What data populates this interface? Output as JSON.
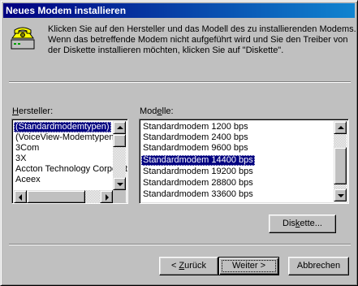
{
  "window": {
    "title": "Neues Modem installieren"
  },
  "intro": {
    "lines": [
      "Klicken Sie auf den Hersteller und das Modell des zu installierenden Modems.",
      "Wenn das betreffende Modem nicht aufgeführt wird und Sie den Treiber von",
      "der Diskette installieren möchten, klicken Sie auf \"Diskette\"."
    ]
  },
  "manufacturers": {
    "label_accel": "H",
    "label_rest": "ersteller:",
    "items": [
      "(Standardmodemtypen)",
      "(VoiceView-Modemtypen)",
      "3Com",
      "3X",
      "Accton Technology Corporation",
      "Aceex"
    ],
    "selected_index": 0
  },
  "models": {
    "label_pre": "Mod",
    "label_accel": "e",
    "label_rest": "lle:",
    "items": [
      "Standardmodem  1200 bps",
      "Standardmodem  2400 bps",
      "Standardmodem  9600 bps",
      "Standardmodem 14400 bps",
      "Standardmodem 19200 bps",
      "Standardmodem 28800 bps",
      "Standardmodem 33600 bps"
    ],
    "selected_index": 3
  },
  "buttons": {
    "disk_pre": "Dis",
    "disk_accel": "k",
    "disk_rest": "ette...",
    "back_pre": "< ",
    "back_accel": "Z",
    "back_rest": "urück",
    "next": "Weiter >",
    "cancel": "Abbrechen"
  },
  "icons": {
    "main": "modem-phone-icon"
  }
}
